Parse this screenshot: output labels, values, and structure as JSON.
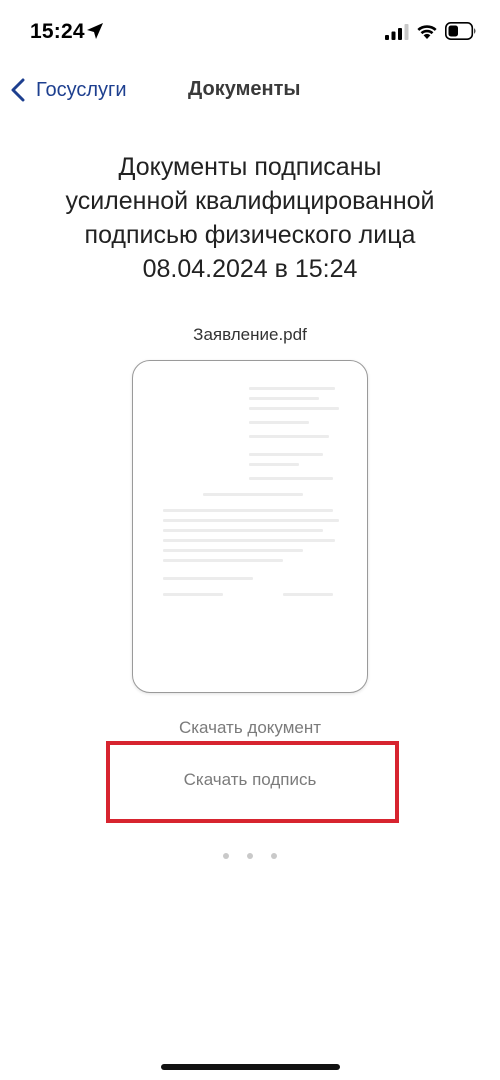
{
  "status_bar": {
    "time": "15:24",
    "icons": [
      "location-arrow-icon",
      "cellular-signal-icon",
      "wifi-icon",
      "battery-icon"
    ]
  },
  "nav": {
    "back_label": "Госуслуги",
    "title": "Документы",
    "accent_color": "#1d3f8f"
  },
  "main": {
    "heading_lines": [
      "Документы подписаны",
      "усиленной квалифицированной",
      "подписью физического лица",
      "08.04.2024 в 15:24"
    ],
    "file_name": "Заявление.pdf",
    "download_document_label": "Скачать документ",
    "download_signature_label": "Скачать подпись",
    "highlight_color": "#d7242f",
    "page_dots_count": 3
  }
}
